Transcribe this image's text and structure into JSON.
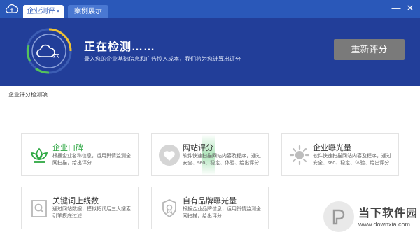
{
  "titlebar": {
    "logo_icon": "cloud-icon",
    "tabs": [
      {
        "label": "企业测评",
        "close": "×",
        "active": true
      },
      {
        "label": "案例展示",
        "active": false
      }
    ],
    "minimize": "—",
    "close": "✕"
  },
  "banner": {
    "ring_glyph": "云",
    "title": "正在检测……",
    "subtitle": "录入您的企业基础信息和广告投入成本，我们将为您计算出评分",
    "rescore_button": "重新评分"
  },
  "section": {
    "title": "企业评分检测项"
  },
  "cards": [
    {
      "title": "企业口碑",
      "desc": "根据企业名称信息，运用舆情监测全网扫描，给出评分",
      "icon": "lotus-icon"
    },
    {
      "title": "网站评分",
      "desc": "软件快速扫描网站内容及程序，通过安全、seo、稳定、体验、给出评分",
      "icon": "heart-icon"
    },
    {
      "title": "企业曝光量",
      "desc": "软件快速扫描网站内容及程序，通过安全、seo、稳定、体验、给出评分",
      "icon": "sun-icon"
    },
    {
      "title": "关键词上线数",
      "desc": "通过网站数据，模拟拓词后三大搜索引擎摸底过滤",
      "icon": "search-doc-icon"
    },
    {
      "title": "自有品牌曝光量",
      "desc": "根据企业品牌信息，运用舆情监测全网扫描，给出评分",
      "icon": "badge-icon"
    }
  ],
  "watermark": {
    "name": "当下软件园",
    "url": "www.downxia.com"
  },
  "colors": {
    "titlebar": "#2a58b9",
    "banner": "#223e99",
    "accent_green": "#2fa844",
    "button_gray": "#7a7a7a"
  }
}
